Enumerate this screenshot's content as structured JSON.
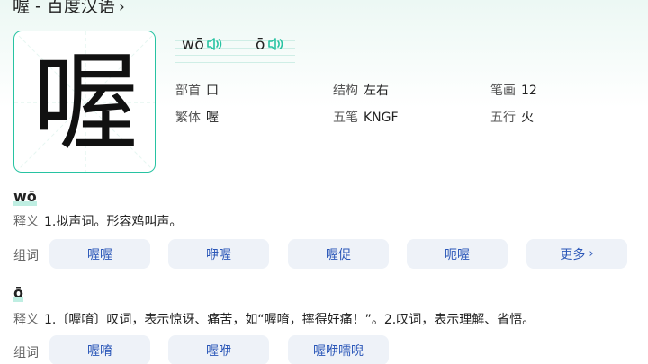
{
  "page": {
    "title": "喔 - 百度汉语",
    "title_chevron": "›"
  },
  "character": {
    "glyph": "喔"
  },
  "pronunciations": [
    {
      "pinyin": "wō"
    },
    {
      "pinyin": "ō"
    }
  ],
  "info": {
    "radical_label": "部首",
    "radical_value": "口",
    "structure_label": "结构",
    "structure_value": "左右",
    "strokes_label": "笔画",
    "strokes_value": "12",
    "traditional_label": "繁体",
    "traditional_value": "喔",
    "wubi_label": "五笔",
    "wubi_value": "KNGF",
    "element_label": "五行",
    "element_value": "火"
  },
  "sections": [
    {
      "pinyin": "wō",
      "def_label": "释义",
      "definition": "1.拟声词。形容鸡叫声。",
      "words_label": "组词",
      "words": [
        "喔喔",
        "咿喔",
        "喔促",
        "呃喔"
      ],
      "more_label": "更多"
    },
    {
      "pinyin": "ō",
      "def_label": "释义",
      "definition": "1.〔喔唷〕叹词，表示惊讶、痛苦，如“喔唷，摔得好痛！”。2.叹词，表示理解、省悟。",
      "words_label": "组词",
      "words": [
        "喔唷",
        "喔咿",
        "喔咿嚅唲"
      ]
    }
  ],
  "colors": {
    "accent": "#27c3a2",
    "chip_bg": "#eef2f8",
    "chip_text": "#2b57b8"
  }
}
